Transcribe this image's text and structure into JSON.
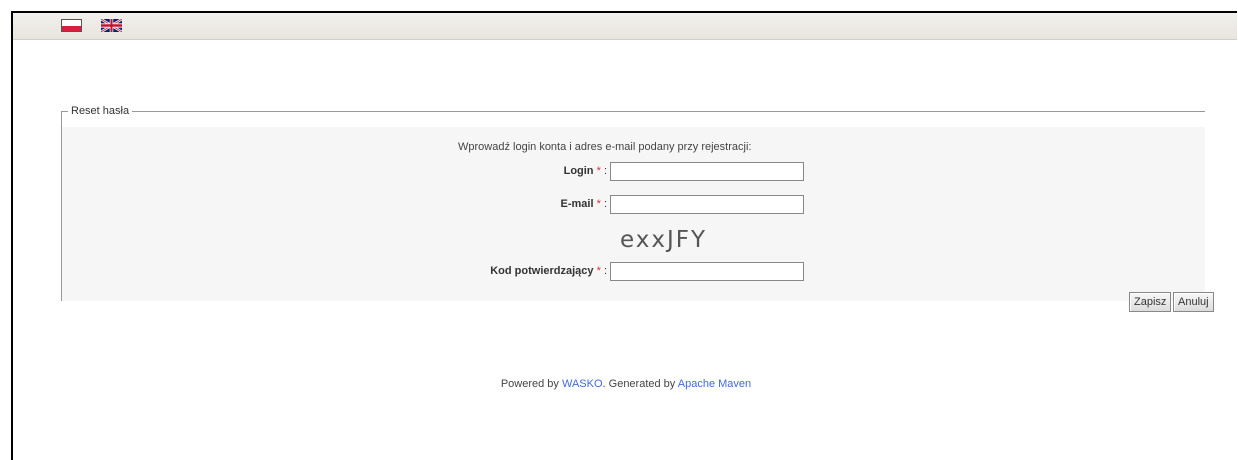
{
  "header": {
    "languages": [
      {
        "code": "pl",
        "icon": "flag-pl-icon"
      },
      {
        "code": "en",
        "icon": "flag-uk-icon"
      }
    ]
  },
  "form": {
    "legend": "Reset hasła",
    "intro": "Wprowadź login konta i adres e-mail podany przy rejestracji:",
    "required_mark": "*",
    "fields": {
      "login": {
        "label": "Login",
        "value": ""
      },
      "email": {
        "label": "E-mail",
        "value": ""
      },
      "code": {
        "label": "Kod potwierdzający",
        "value": ""
      }
    },
    "captcha_text": "exxJFY",
    "buttons": {
      "save": "Zapisz",
      "cancel": "Anuluj"
    }
  },
  "footer": {
    "prefix": "Powered by",
    "wasko_link": "WASKO",
    "middle": ". Generated by",
    "maven_link": "Apache Maven"
  },
  "colors": {
    "required": "#dd3333",
    "link": "#4169e1",
    "panel": "#f6f6f6"
  }
}
